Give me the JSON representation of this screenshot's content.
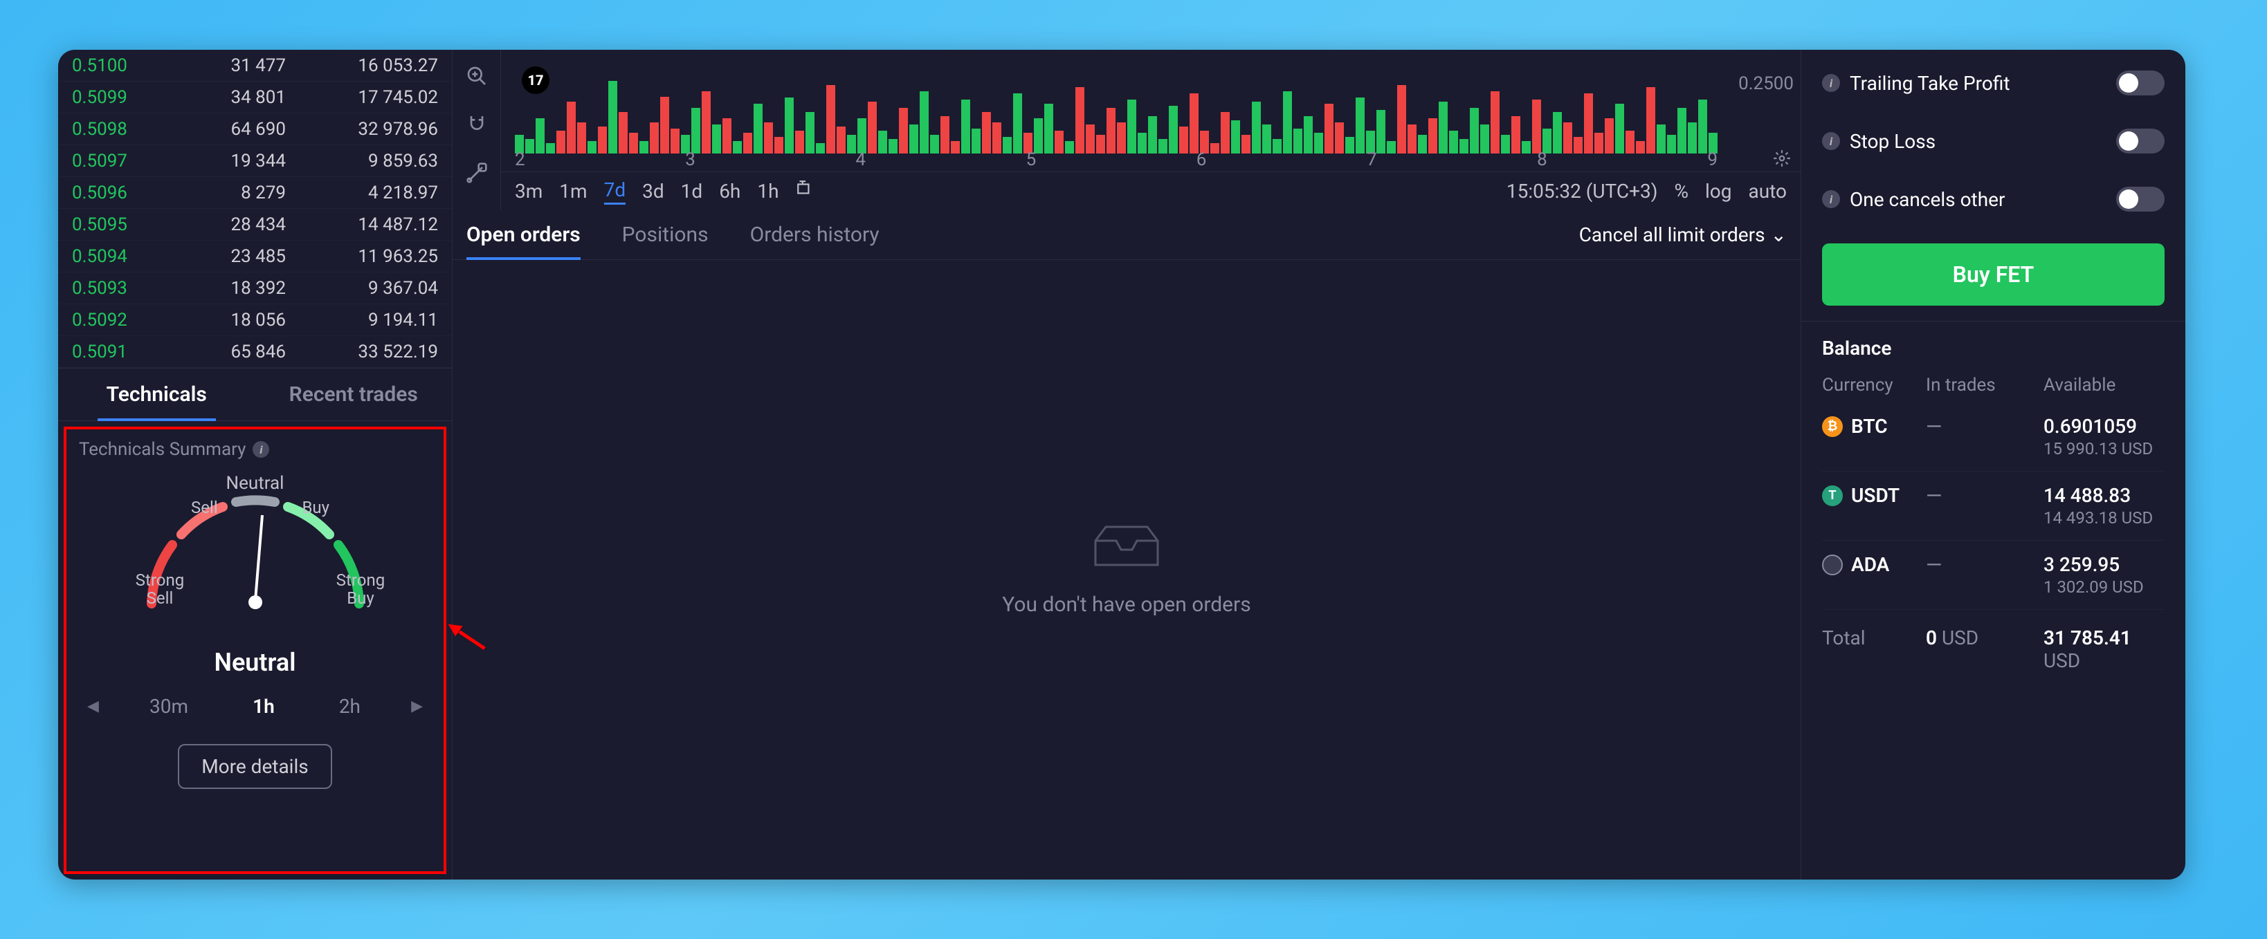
{
  "orderbook": [
    {
      "price": "0.5100",
      "amount": "31 477",
      "total": "16 053.27"
    },
    {
      "price": "0.5099",
      "amount": "34 801",
      "total": "17 745.02"
    },
    {
      "price": "0.5098",
      "amount": "64 690",
      "total": "32 978.96"
    },
    {
      "price": "0.5097",
      "amount": "19 344",
      "total": "9 859.63"
    },
    {
      "price": "0.5096",
      "amount": "8 279",
      "total": "4 218.97"
    },
    {
      "price": "0.5095",
      "amount": "28 434",
      "total": "14 487.12"
    },
    {
      "price": "0.5094",
      "amount": "23 485",
      "total": "11 963.25"
    },
    {
      "price": "0.5093",
      "amount": "18 392",
      "total": "9 367.04"
    },
    {
      "price": "0.5092",
      "amount": "18 056",
      "total": "9 194.11"
    },
    {
      "price": "0.5091",
      "amount": "65 846",
      "total": "33 522.19"
    }
  ],
  "left_tabs": {
    "technicals": "Technicals",
    "recent": "Recent trades"
  },
  "technicals": {
    "header": "Technicals Summary",
    "neutral": "Neutral",
    "sell": "Sell",
    "buy": "Buy",
    "strong_sell": "Strong Sell",
    "strong_buy": "Strong Buy",
    "result": "Neutral",
    "tf": {
      "a": "30m",
      "b": "1h",
      "c": "2h"
    },
    "more": "More details"
  },
  "chart": {
    "price_tag": "0.2500",
    "x_ticks": [
      "2",
      "3",
      "4",
      "5",
      "6",
      "7",
      "8",
      "9"
    ],
    "timeframes": [
      "3m",
      "1m",
      "7d",
      "3d",
      "1d",
      "6h",
      "1h"
    ],
    "active_tf": "7d",
    "clock": "15:05:32 (UTC+3)",
    "pct": "%",
    "log": "log",
    "auto": "auto"
  },
  "orders": {
    "tabs": {
      "open": "Open orders",
      "positions": "Positions",
      "history": "Orders history"
    },
    "cancel_all": "Cancel all limit orders",
    "empty": "You don't have open orders"
  },
  "right": {
    "toggles": {
      "ttp": "Trailing Take Profit",
      "sl": "Stop Loss",
      "oco": "One cancels other"
    },
    "buy": "Buy FET",
    "balance_title": "Balance",
    "headers": {
      "cur": "Currency",
      "intrade": "In trades",
      "avail": "Available"
    },
    "rows": [
      {
        "sym": "BTC",
        "badge": "₿",
        "cls": "coin-btc",
        "intrade": "—",
        "amt": "0.6901059",
        "usd": "15 990.13 USD"
      },
      {
        "sym": "USDT",
        "badge": "T",
        "cls": "coin-usdt",
        "intrade": "—",
        "amt": "14 488.83",
        "usd": "14 493.18 USD"
      },
      {
        "sym": "ADA",
        "badge": "",
        "cls": "coin-ada",
        "intrade": "—",
        "amt": "3 259.95",
        "usd": "1 302.09 USD"
      }
    ],
    "total": {
      "label": "Total",
      "zero": "0",
      "zero_unit": "USD",
      "sum": "31 785.41",
      "sum_unit": "USD"
    }
  },
  "chart_data": {
    "type": "bar",
    "note": "Volume histogram, approximate relative heights",
    "x_range": [
      2,
      9
    ],
    "series": [
      {
        "name": "volume",
        "values": "mixed red/green bars"
      }
    ]
  }
}
